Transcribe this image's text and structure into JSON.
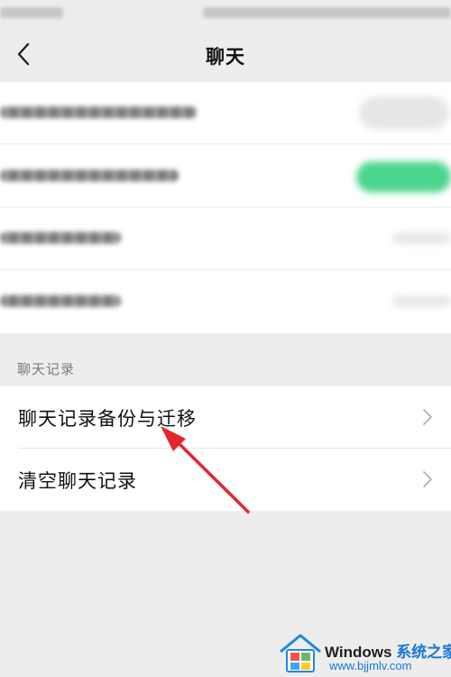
{
  "nav": {
    "title": "聊天",
    "back_icon": "chevron-left-icon"
  },
  "section": {
    "header": "聊天记录"
  },
  "history_items": [
    {
      "label": "聊天记录备份与迁移",
      "icon": "chevron-right-icon"
    },
    {
      "label": "清空聊天记录",
      "icon": "chevron-right-icon"
    }
  ],
  "watermark": {
    "brand": "Windows",
    "brand_cn": "系统之家",
    "url": "www.bjjmlv.com",
    "logo": "windows-logo-icon"
  },
  "colors": {
    "background": "#ededed",
    "card": "#ffffff",
    "toggle_on": "#4cd58c",
    "arrow": "#e3262c",
    "accent_blue": "#1976d2"
  }
}
